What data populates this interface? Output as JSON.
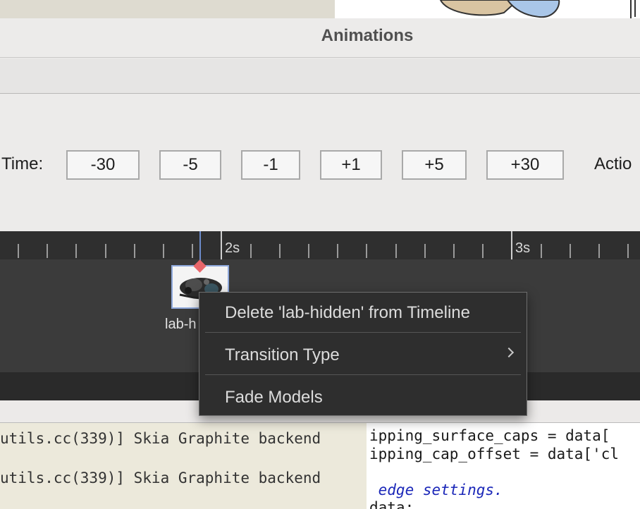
{
  "window": {
    "title": "Animations"
  },
  "time_controls": {
    "label": "Time:",
    "buttons": [
      "-30",
      "-5",
      "-1",
      "+1",
      "+5",
      "+30"
    ],
    "action_label": "Actio"
  },
  "timeline": {
    "second_labels": [
      "2s",
      "3s"
    ],
    "clip_label": "lab-h"
  },
  "context_menu": {
    "items": [
      {
        "label": "Delete 'lab-hidden' from Timeline"
      },
      {
        "label": "Transition Type",
        "has_submenu": true
      },
      {
        "label": "Fade Models"
      }
    ]
  },
  "background": {
    "log_lines": [
      "utils.cc(339)] Skia Graphite backend",
      "utils.cc(339)] Skia Graphite backend"
    ],
    "code_lines": [
      "ipping_surface_caps = data[",
      "ipping_cap_offset = data['cl",
      " edge settings.",
      "data:"
    ]
  },
  "colors": {
    "timeline_bg": "#2f2f2f",
    "track_bg": "#3b3b3b",
    "keyframe": "#e8666a",
    "playhead": "#6c8ccc",
    "code_comment": "#1a26b8"
  }
}
